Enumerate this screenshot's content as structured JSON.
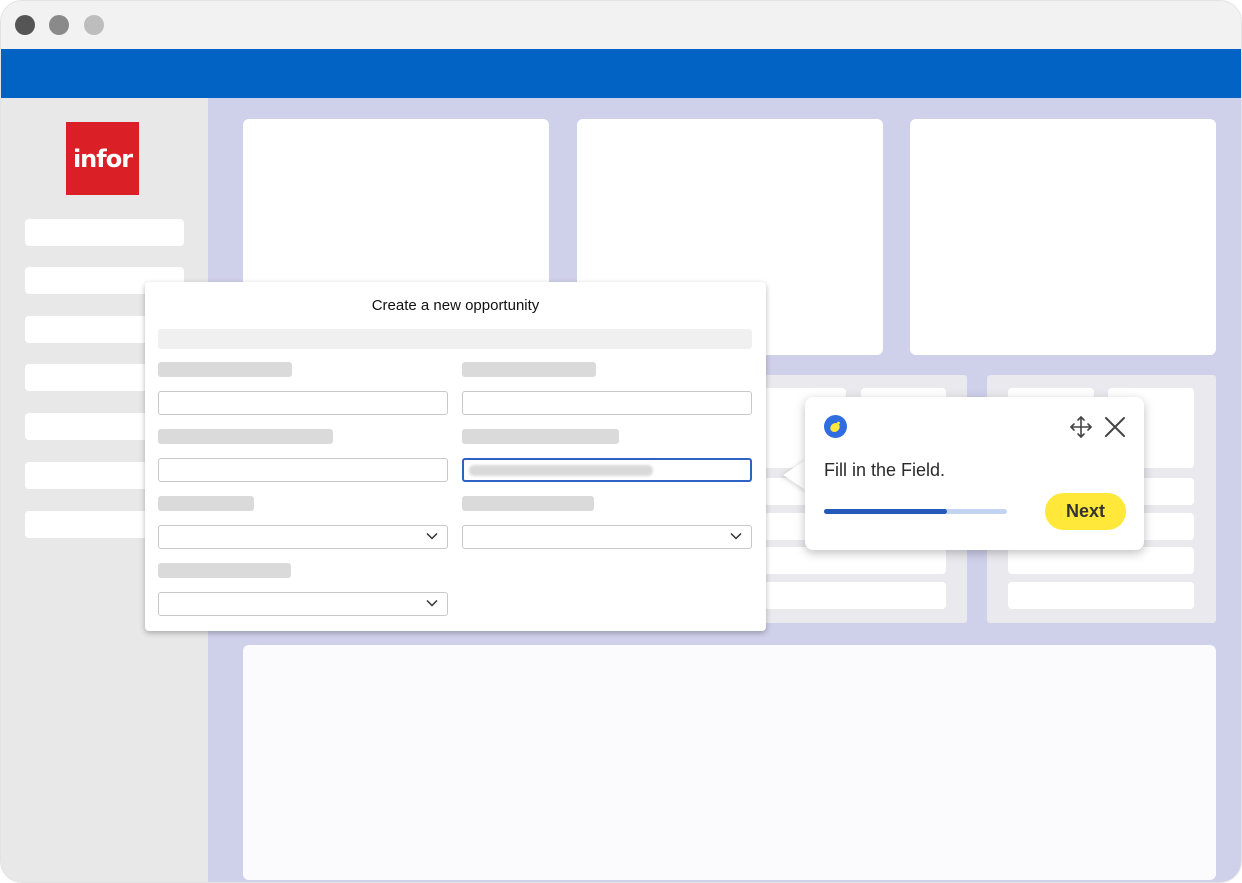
{
  "window": {
    "controls": [
      "close",
      "minimize",
      "maximize"
    ]
  },
  "brand": {
    "logo_text": "infor",
    "color": "#da1f26"
  },
  "dialog": {
    "title": "Create a new opportunity",
    "active_field": "right-field-2"
  },
  "tooltip": {
    "message": "Fill in the Field.",
    "next_label": "Next",
    "progress": 0.67,
    "icons": [
      "app-logo-icon",
      "move-icon",
      "close-icon"
    ]
  },
  "colors": {
    "header_blue": "#0263c4",
    "content_bg": "#cfd0ea",
    "next_button": "#ffe83a",
    "progress_fill": "#2559b8"
  }
}
